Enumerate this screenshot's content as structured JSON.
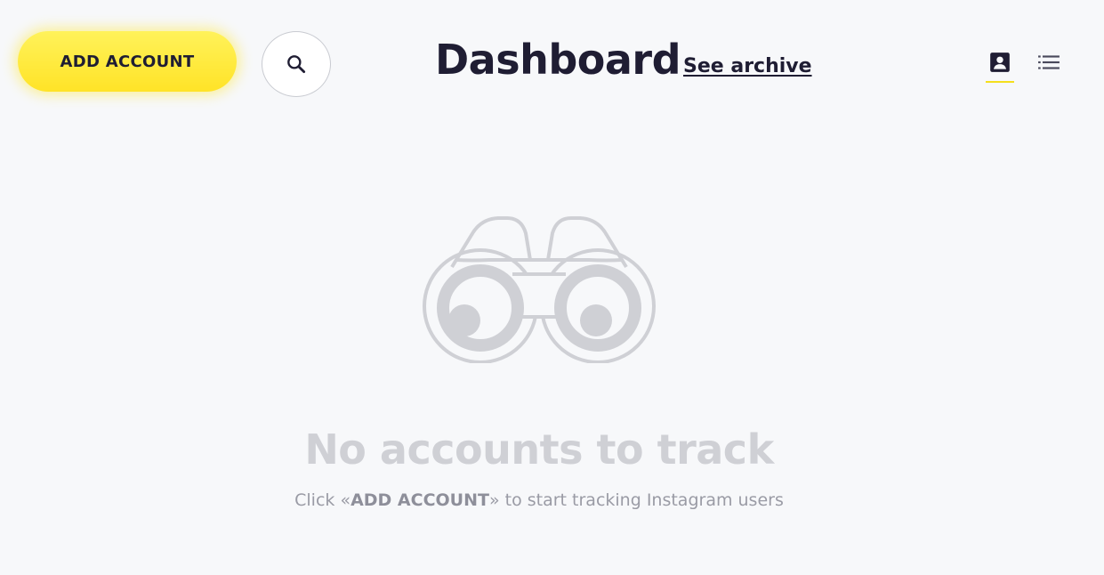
{
  "toolbar": {
    "add_account_label": "ADD ACCOUNT",
    "search_icon": "search-icon"
  },
  "header": {
    "title": "Dashboard",
    "archive_link": "See archive"
  },
  "view_toggles": {
    "active": "cards",
    "items": [
      {
        "name": "cards",
        "icon": "contact-card-icon"
      },
      {
        "name": "list",
        "icon": "list-icon"
      }
    ]
  },
  "empty_state": {
    "illustration": "binoculars-icon",
    "title": "No accounts to track",
    "hint_prefix": "Click «",
    "hint_action": "ADD ACCOUNT",
    "hint_suffix": "» to start tracking Instagram users"
  },
  "colors": {
    "accent_yellow": "#ffe327",
    "text_dark": "#1f1d33",
    "muted": "#cfd0d5",
    "background": "#f7f8fa"
  }
}
